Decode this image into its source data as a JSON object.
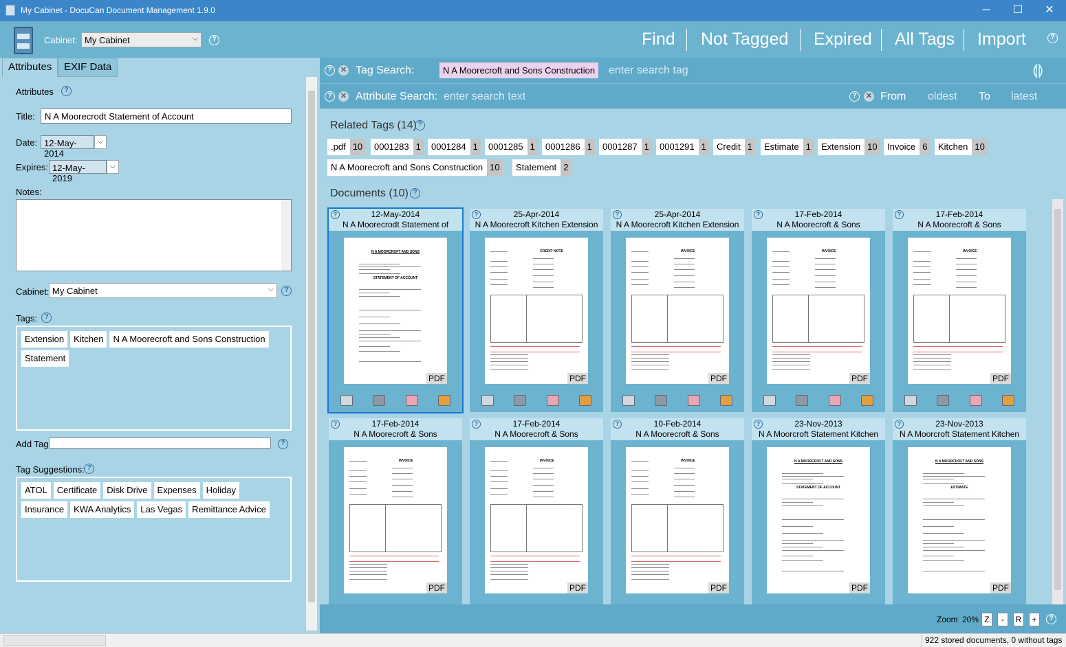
{
  "window": {
    "title": "My Cabinet - DocuCan Document Management 1.9.0",
    "min": "─",
    "max": "☐",
    "close": "✕"
  },
  "toolbar": {
    "cabinet_label": "Cabinet:",
    "cabinet_value": "My Cabinet",
    "nav": [
      "Find",
      "Not Tagged",
      "Expired",
      "All Tags",
      "Import"
    ],
    "help": "?"
  },
  "left": {
    "tabs": [
      "Attributes",
      "EXIF Data"
    ],
    "attributes_heading": "Attributes",
    "title_label": "Title:",
    "title_value": "N A Moorecrodt Statement of Account",
    "date_label": "Date:",
    "date_value": "12-May-2014",
    "expires_label": "Expires:",
    "expires_value": "12-May-2019",
    "notes_label": "Notes:",
    "cabinet_label": "Cabinet:",
    "cabinet_value": "My Cabinet",
    "tags_label": "Tags:",
    "tags": [
      "Extension",
      "Kitchen",
      "N A Moorecroft and Sons Construction",
      "Statement"
    ],
    "add_tag_label": "Add Tag:",
    "suggestions_label": "Tag Suggestions:",
    "suggestions": [
      "ATOL",
      "Certificate",
      "Disk Drive",
      "Expenses",
      "Holiday",
      "Insurance",
      "KWA Analytics",
      "Las Vegas",
      "Remittance Advice"
    ]
  },
  "search": {
    "tag_label": "Tag Search:",
    "tag_active": "N A Moorecroft and Sons Construction",
    "tag_placeholder": "enter search tag",
    "attr_label": "Attribute Search:",
    "attr_placeholder": "enter search text",
    "from_label": "From",
    "from_value": "oldest",
    "to_label": "To",
    "to_value": "latest"
  },
  "related": {
    "heading": "Related Tags (14)",
    "tags": [
      {
        "name": ".pdf",
        "count": "10"
      },
      {
        "name": "0001283",
        "count": "1"
      },
      {
        "name": "0001284",
        "count": "1"
      },
      {
        "name": "0001285",
        "count": "1"
      },
      {
        "name": "0001286",
        "count": "1"
      },
      {
        "name": "0001287",
        "count": "1"
      },
      {
        "name": "0001291",
        "count": "1"
      },
      {
        "name": "Credit",
        "count": "1"
      },
      {
        "name": "Estimate",
        "count": "1"
      },
      {
        "name": "Extension",
        "count": "10"
      },
      {
        "name": "Invoice",
        "count": "6"
      },
      {
        "name": "Kitchen",
        "count": "10"
      },
      {
        "name": "N A Moorecroft and Sons Construction",
        "count": "10"
      },
      {
        "name": "Statement",
        "count": "2"
      }
    ]
  },
  "documents": {
    "heading": "Documents (10)",
    "items": [
      {
        "date": "12-May-2014",
        "title": "N A Moorecrodt Statement of",
        "type": "PDF",
        "heading": "N A MOORCROFT AND SONS",
        "doc": "STATEMENT OF ACCOUNT"
      },
      {
        "date": "25-Apr-2014",
        "title": "N A Moorecroft Kitchen Extension",
        "type": "PDF",
        "heading": "",
        "doc": "CREDIT NOTE"
      },
      {
        "date": "25-Apr-2014",
        "title": "N A Moorecroft Kitchen Extension",
        "type": "PDF",
        "heading": "",
        "doc": "INVOICE"
      },
      {
        "date": "17-Feb-2014",
        "title": "N A Moorecroft & Sons",
        "type": "PDF",
        "heading": "",
        "doc": "INVOICE"
      },
      {
        "date": "17-Feb-2014",
        "title": "N A Moorecroft & Sons",
        "type": "PDF",
        "heading": "",
        "doc": "INVOICE"
      },
      {
        "date": "17-Feb-2014",
        "title": "N A Moorecroft & Sons",
        "type": "PDF",
        "heading": "",
        "doc": "INVOICE"
      },
      {
        "date": "17-Feb-2014",
        "title": "N A Moorecroft & Sons",
        "type": "PDF",
        "heading": "",
        "doc": "INVOICE"
      },
      {
        "date": "10-Feb-2014",
        "title": "N A Moorecroft & Sons",
        "type": "PDF",
        "heading": "",
        "doc": "INVOICE"
      },
      {
        "date": "23-Nov-2013",
        "title": "N A Moorcroft Statement Kitchen",
        "type": "PDF",
        "heading": "N A MOORCROFT AND SONS",
        "doc": "STATEMENT OF ACCOUNT"
      },
      {
        "date": "23-Nov-2013",
        "title": "N A Moorcroft Statement Kitchen",
        "type": "PDF",
        "heading": "N A MOORCROFT AND SONS",
        "doc": "ESTIMATE"
      }
    ]
  },
  "zoom": {
    "label": "Zoom",
    "value": "20%",
    "buttons": [
      "Z",
      "-",
      "R",
      "+"
    ]
  },
  "status": {
    "text": "922 stored documents, 0 without tags"
  },
  "colors": {
    "accent": "#3a86c9",
    "panel": "#a9d4e6",
    "bar": "#5fa9c9",
    "selected": "#1677d2",
    "tag_highlight": "#ecd2ec"
  }
}
